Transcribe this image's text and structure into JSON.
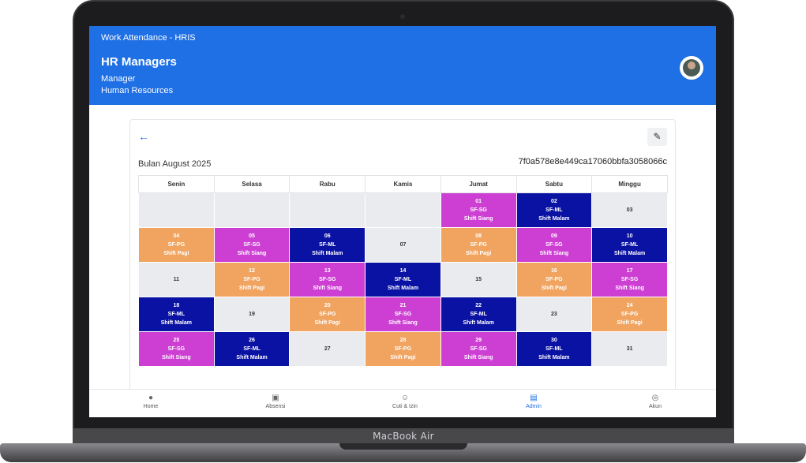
{
  "device": {
    "brand": "MacBook Air"
  },
  "header": {
    "app_title": "Work Attendance - HRIS",
    "user_name": "HR Managers",
    "role": "Manager",
    "department": "Human Resources"
  },
  "schedule": {
    "back_icon": "arrow-left-icon",
    "edit_icon": "pencil-icon",
    "month_label": "Bulan August 2025",
    "code": "7f0a578e8e449ca17060bbfa3058066c",
    "weekdays": [
      "Senin",
      "Selasa",
      "Rabu",
      "Kamis",
      "Jumat",
      "Sabtu",
      "Minggu"
    ],
    "weeks": [
      [
        {
          "day": "",
          "code": "",
          "shift": "",
          "type": "empty"
        },
        {
          "day": "",
          "code": "",
          "shift": "",
          "type": "empty"
        },
        {
          "day": "",
          "code": "",
          "shift": "",
          "type": "empty"
        },
        {
          "day": "",
          "code": "",
          "shift": "",
          "type": "empty"
        },
        {
          "day": "01",
          "code": "SF-SG",
          "shift": "Shift Siang",
          "type": "sg"
        },
        {
          "day": "02",
          "code": "SF-ML",
          "shift": "Shift Malam",
          "type": "ml"
        },
        {
          "day": "03",
          "code": "",
          "shift": "",
          "type": "plain"
        }
      ],
      [
        {
          "day": "04",
          "code": "SF-PG",
          "shift": "Shift Pagi",
          "type": "pg"
        },
        {
          "day": "05",
          "code": "SF-SG",
          "shift": "Shift Siang",
          "type": "sg"
        },
        {
          "day": "06",
          "code": "SF-ML",
          "shift": "Shift Malam",
          "type": "ml"
        },
        {
          "day": "07",
          "code": "",
          "shift": "",
          "type": "plain"
        },
        {
          "day": "08",
          "code": "SF-PG",
          "shift": "Shift Pagi",
          "type": "pg"
        },
        {
          "day": "09",
          "code": "SF-SG",
          "shift": "Shift Siang",
          "type": "sg"
        },
        {
          "day": "10",
          "code": "SF-ML",
          "shift": "Shift Malam",
          "type": "ml"
        }
      ],
      [
        {
          "day": "11",
          "code": "",
          "shift": "",
          "type": "plain"
        },
        {
          "day": "12",
          "code": "SF-PG",
          "shift": "Shift Pagi",
          "type": "pg"
        },
        {
          "day": "13",
          "code": "SF-SG",
          "shift": "Shift Siang",
          "type": "sg"
        },
        {
          "day": "14",
          "code": "SF-ML",
          "shift": "Shift Malam",
          "type": "ml"
        },
        {
          "day": "15",
          "code": "",
          "shift": "",
          "type": "plain"
        },
        {
          "day": "16",
          "code": "SF-PG",
          "shift": "Shift Pagi",
          "type": "pg"
        },
        {
          "day": "17",
          "code": "SF-SG",
          "shift": "Shift Siang",
          "type": "sg"
        }
      ],
      [
        {
          "day": "18",
          "code": "SF-ML",
          "shift": "Shift Malam",
          "type": "ml"
        },
        {
          "day": "19",
          "code": "",
          "shift": "",
          "type": "plain"
        },
        {
          "day": "20",
          "code": "SF-PG",
          "shift": "Shift Pagi",
          "type": "pg"
        },
        {
          "day": "21",
          "code": "SF-SG",
          "shift": "Shift Siang",
          "type": "sg"
        },
        {
          "day": "22",
          "code": "SF-ML",
          "shift": "Shift Malam",
          "type": "ml"
        },
        {
          "day": "23",
          "code": "",
          "shift": "",
          "type": "plain"
        },
        {
          "day": "24",
          "code": "SF-PG",
          "shift": "Shift Pagi",
          "type": "pg"
        }
      ],
      [
        {
          "day": "25",
          "code": "SF-SG",
          "shift": "Shift Siang",
          "type": "sg"
        },
        {
          "day": "26",
          "code": "SF-ML",
          "shift": "Shift Malam",
          "type": "ml"
        },
        {
          "day": "27",
          "code": "",
          "shift": "",
          "type": "plain"
        },
        {
          "day": "28",
          "code": "SF-PG",
          "shift": "Shift Pagi",
          "type": "pg"
        },
        {
          "day": "29",
          "code": "SF-SG",
          "shift": "Shift Siang",
          "type": "sg"
        },
        {
          "day": "30",
          "code": "SF-ML",
          "shift": "Shift Malam",
          "type": "ml"
        },
        {
          "day": "31",
          "code": "",
          "shift": "",
          "type": "plain"
        }
      ]
    ],
    "colors": {
      "sg": "#cd3fd3",
      "ml": "#0a12a3",
      "pg": "#f0a460",
      "off": "#e9ebee"
    }
  },
  "bottom_nav": [
    {
      "label": "Home",
      "icon": "apple-icon",
      "active": false
    },
    {
      "label": "Absensi",
      "icon": "calendar-icon",
      "active": false
    },
    {
      "label": "Cuti & Izin",
      "icon": "user-check-icon",
      "active": false
    },
    {
      "label": "Admin",
      "icon": "clipboard-icon",
      "active": true
    },
    {
      "label": "Akun",
      "icon": "user-circle-icon",
      "active": false
    }
  ],
  "accent_color": "#1f6fe5"
}
